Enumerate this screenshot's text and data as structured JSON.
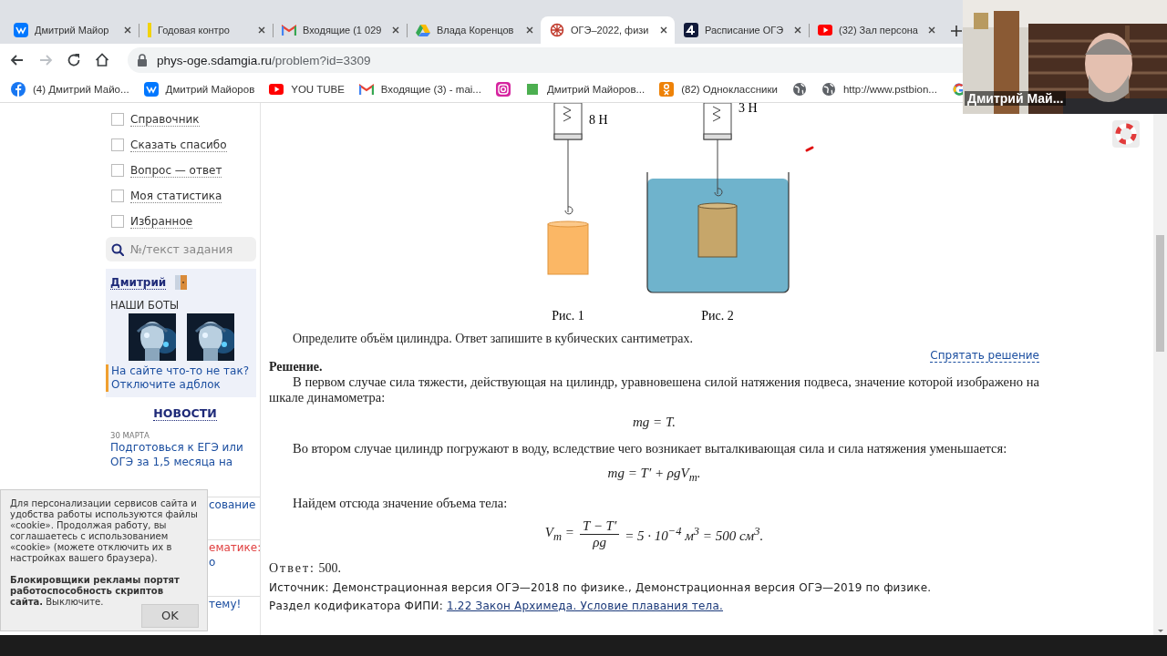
{
  "browser": {
    "tabs": [
      {
        "title": "Дмитрий Майор",
        "kind": "vk",
        "selected": false
      },
      {
        "title": "Годовая контро",
        "kind": "bar",
        "selected": false
      },
      {
        "title": "Входящие (1 029",
        "kind": "mail",
        "selected": false
      },
      {
        "title": "Влада Коренцов",
        "kind": "drive",
        "selected": false
      },
      {
        "title": "ОГЭ–2022, физи",
        "kind": "wheel",
        "selected": true
      },
      {
        "title": "Расписание ОГЭ",
        "kind": "four",
        "selected": false
      },
      {
        "title": "(32) Зал персона",
        "kind": "play",
        "selected": false
      }
    ],
    "nav": [
      {
        "kind": "back",
        "disabled": false
      },
      {
        "kind": "forward",
        "disabled": true
      },
      {
        "kind": "reload",
        "disabled": false
      },
      {
        "kind": "home",
        "disabled": false
      }
    ],
    "address": {
      "host": "phys-oge.sdamgia.ru",
      "path": "/problem?id=3309"
    },
    "bookmarks": [
      {
        "title": "(4) Дмитрий Майо...",
        "kind": "fb"
      },
      {
        "title": "Дмитрий Майоров",
        "kind": "vk"
      },
      {
        "title": "YOU TUBE",
        "kind": "play"
      },
      {
        "title": "Входящие (3) - mai...",
        "kind": "mail"
      },
      {
        "kind": "insta"
      },
      {
        "title": "Дмитрий Майоров...",
        "kind": "square"
      },
      {
        "title": "(82) Одноклассники",
        "kind": "ok"
      },
      {
        "kind": "globe"
      },
      {
        "title": "http://www.pstbion...",
        "kind": "globe"
      },
      {
        "kind": "google"
      }
    ]
  },
  "sidebar": {
    "menu": [
      {
        "label": "Справочник",
        "checked": false
      },
      {
        "label": "Сказать спасибо",
        "checked": false
      },
      {
        "label": "Вопрос — ответ",
        "checked": false
      },
      {
        "label": "Моя статистика",
        "checked": false
      },
      {
        "label": "Избранное",
        "checked": false
      }
    ],
    "search": {
      "placeholder": "№/текст задания"
    },
    "user": {
      "name": "Дмитрий"
    },
    "bots_heading": "НАШИ БОТЫ",
    "adblock_note": "На сайте что-то не так? Отключите адблок",
    "news": {
      "heading": "НОВОСТИ",
      "date": "30 МАРТА",
      "text": "Подготовься к ЕГЭ или ОГЭ за 1,5 месяца на"
    },
    "partly_hidden": [
      {
        "text": "сование",
        "kind": "link"
      },
      {
        "text": "ематике:",
        "kind": "alert"
      },
      {
        "text": "о",
        "kind": "link"
      },
      {
        "text": "тему!",
        "kind": "link"
      }
    ]
  },
  "problem": {
    "figures": [
      {
        "kind": "hanging",
        "force": "8 Н",
        "caption": "Рис. 1"
      },
      {
        "kind": "submerged",
        "force": "3 Н",
        "caption": "Рис. 2"
      }
    ],
    "question": "Определите объём цилиндра. Ответ запишите в кубических сантиметрах.",
    "toggle_link": "Спрятать решение",
    "solution_heading": "Решение.",
    "steps": [
      {
        "kind": "text",
        "text": "В первом случае сила тяжести, действующая на цилиндр, уравновешена силой натяжения подвеса, значение которой изображено на шкале динамометра:"
      },
      {
        "kind": "formula",
        "text": "mg = T."
      },
      {
        "kind": "text",
        "text": "Во втором случае цилиндр погружают в воду, вследствие чего возникает выталкивающая сила и сила натяжения уменьшается:"
      },
      {
        "kind": "formula",
        "text": "mg = T′ + ρgV$_{т}$."
      },
      {
        "kind": "text",
        "text": "Найдем отсюда значение объема тела:"
      },
      {
        "kind": "fraction",
        "lhs": "V$_{т}$ =",
        "numerator": "T − T′",
        "denominator": "ρg",
        "rhs": "= 5 · 10$^{−4}$ м$^{3}$ = 500 см$^{3}$."
      }
    ],
    "answer": {
      "label": "Ответ:",
      "value": "500."
    },
    "source": "Источник: Демонстрационная версия ОГЭ—2018 по физике., Демонстрационная версия ОГЭ—2019 по физике.",
    "codifier": {
      "label": "Раздел кодификатора ФИПИ:",
      "link": "1.22 Закон Архимеда. Условие плавания тела."
    }
  },
  "cookie_notice": {
    "text": "Для персонализации сервисов сайта и удобства работы используются файлы «cookie». Продолжая работу, вы соглашаетесь с использованием «cookie» (можете отключить их в настройках вашего браузера).",
    "warning": "**Блокировщики рекламы портят работоспособность скриптов сайта.** Выключите.",
    "button": "OK"
  },
  "video": {
    "name": "Дмитрий Май..."
  }
}
